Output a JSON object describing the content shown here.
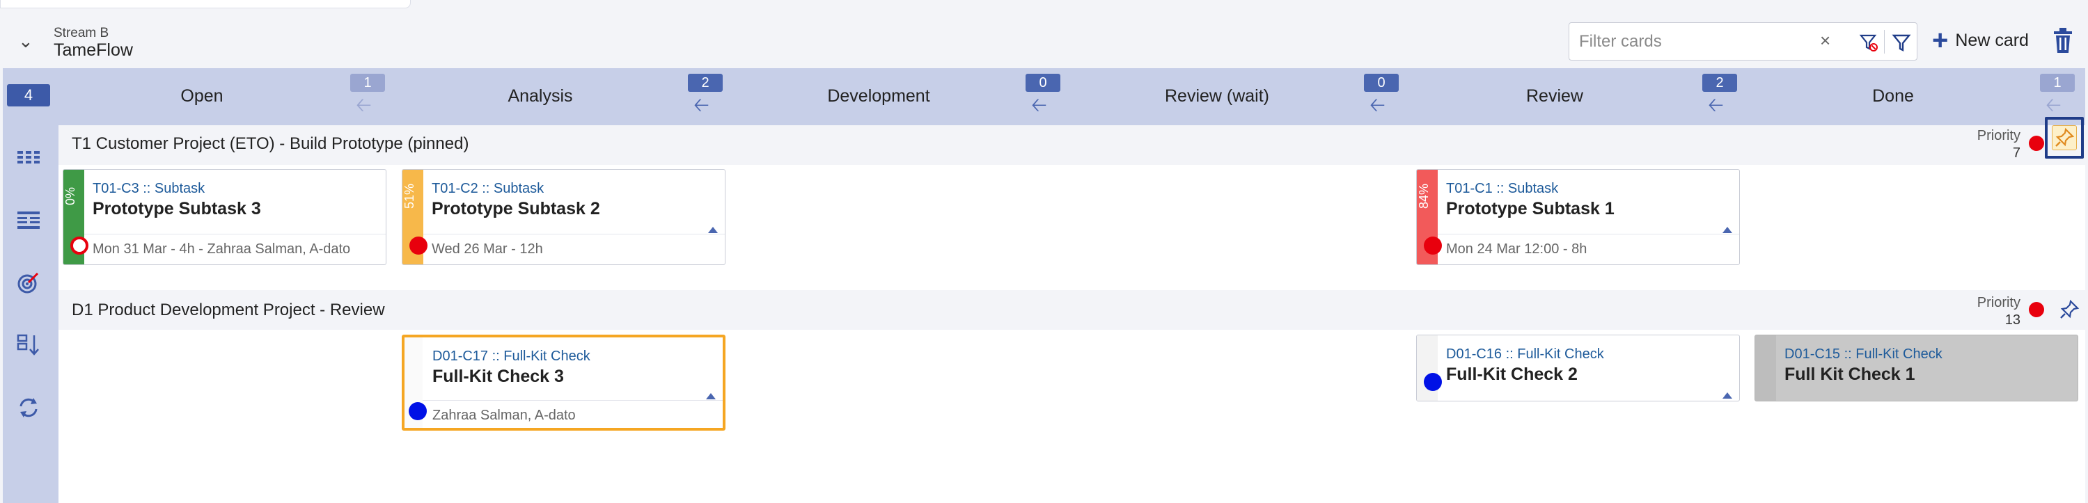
{
  "stream": {
    "label": "Stream B",
    "title": "TameFlow"
  },
  "toolbar": {
    "filter_placeholder": "Filter cards",
    "new_card_label": "New card"
  },
  "board": {
    "count": "4",
    "columns": [
      {
        "label": "Open"
      },
      {
        "label": "Analysis",
        "wip": "1"
      },
      {
        "label": "Development",
        "wip": "2"
      },
      {
        "label": "Review (wait)",
        "wip": "0"
      },
      {
        "label": "Review",
        "wip": "0"
      },
      {
        "label": "Done",
        "wip": "2"
      }
    ],
    "last_wip": "1",
    "lanes": [
      {
        "title": "T1 Customer Project (ETO) - Build Prototype (pinned)",
        "priority_label": "Priority",
        "priority": "7",
        "cards": [
          {
            "id": "T01-C3 :: Subtask",
            "title": "Prototype Subtask 3",
            "meta": "Mon 31 Mar - 4h - Zahraa Salman, A-dato",
            "pct": "0%",
            "color": "#3f9a46",
            "progress": 0
          },
          {
            "id": "T01-C2 :: Subtask",
            "title": "Prototype Subtask 2",
            "meta": "Wed 26 Mar - 12h",
            "pct": "51%",
            "color": "#f7b84a",
            "progress": 51
          },
          {
            "id": "T01-C1 :: Subtask",
            "title": "Prototype Subtask 1",
            "meta": "Mon 24 Mar 12:00 - 8h",
            "pct": "84%",
            "color": "#f25a5a",
            "progress": 84
          }
        ]
      },
      {
        "title": "D1 Product Development Project - Review",
        "priority_label": "Priority",
        "priority": "13",
        "cards": [
          {
            "id": "D01-C17 :: Full-Kit Check",
            "title": "Full-Kit Check 3",
            "meta": "Zahraa Salman, A-dato",
            "color": "#f5a623"
          },
          {
            "id": "D01-C16 :: Full-Kit Check",
            "title": "Full-Kit Check 2"
          },
          {
            "id": "D01-C15 :: Full-Kit Check",
            "title": "Full Kit Check 1"
          }
        ]
      }
    ]
  }
}
